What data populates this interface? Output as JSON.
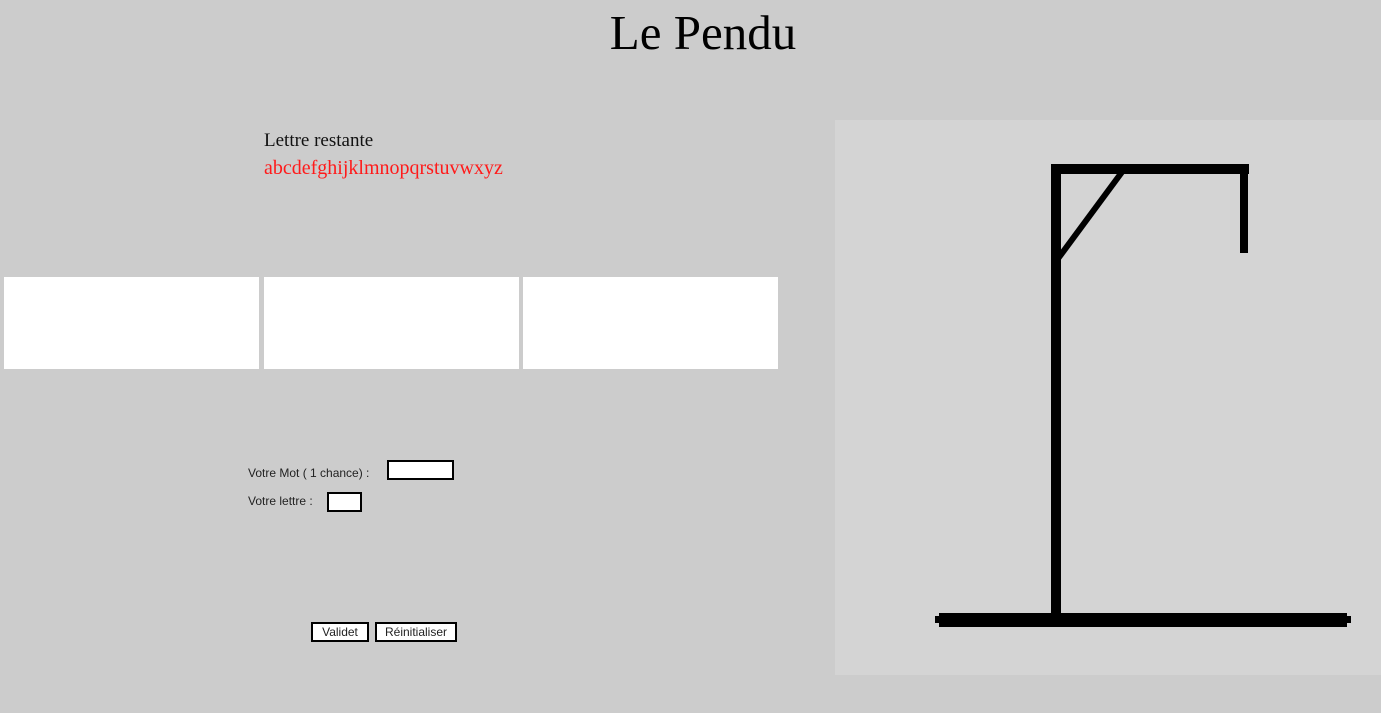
{
  "title": "Le Pendu",
  "remaining": {
    "label": "Lettre restante",
    "letters": "abcdefghijklmnopqrstuvwxyz"
  },
  "form": {
    "word_label": "Votre Mot ( 1 chance) :",
    "word_value": "",
    "letter_label": "Votre lettre :",
    "letter_value": ""
  },
  "buttons": {
    "validate_label": "Validet",
    "reset_label": "Réinitialiser"
  },
  "colors": {
    "background": "#cccccc",
    "panel": "#d4d4d4",
    "remaining_letters": "#ff1a1a"
  }
}
